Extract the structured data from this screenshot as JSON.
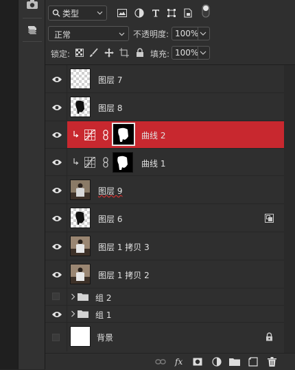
{
  "toolbar": {
    "filter_kind": "类型",
    "blend_mode": "正常",
    "opacity_label": "不透明度:",
    "opacity_value": "100%",
    "lock_label": "锁定:",
    "fill_label": "填充:",
    "fill_value": "100%"
  },
  "layers": [
    {
      "name": "图层 7",
      "visible": true,
      "thumb": "checker"
    },
    {
      "name": "图层 8",
      "visible": true,
      "thumb": "checker-shape"
    },
    {
      "name": "曲线 2",
      "visible": true,
      "thumb": "adjustment",
      "selected": true,
      "clipped": true
    },
    {
      "name": "曲线 1",
      "visible": true,
      "thumb": "adjustment",
      "clipped": true
    },
    {
      "name": "图层 9",
      "visible": true,
      "thumb": "photo"
    },
    {
      "name": "图层 6",
      "visible": true,
      "thumb": "checker-shape",
      "smart_object": true
    },
    {
      "name": "图层 1 拷贝 3",
      "visible": true,
      "thumb": "photo"
    },
    {
      "name": "图层 1 拷贝 2",
      "visible": true,
      "thumb": "photo"
    },
    {
      "name": "组 2",
      "visible": false,
      "type": "group"
    },
    {
      "name": "组 1",
      "visible": true,
      "type": "group"
    },
    {
      "name": "背景",
      "visible": false,
      "thumb": "white",
      "locked": true
    }
  ]
}
